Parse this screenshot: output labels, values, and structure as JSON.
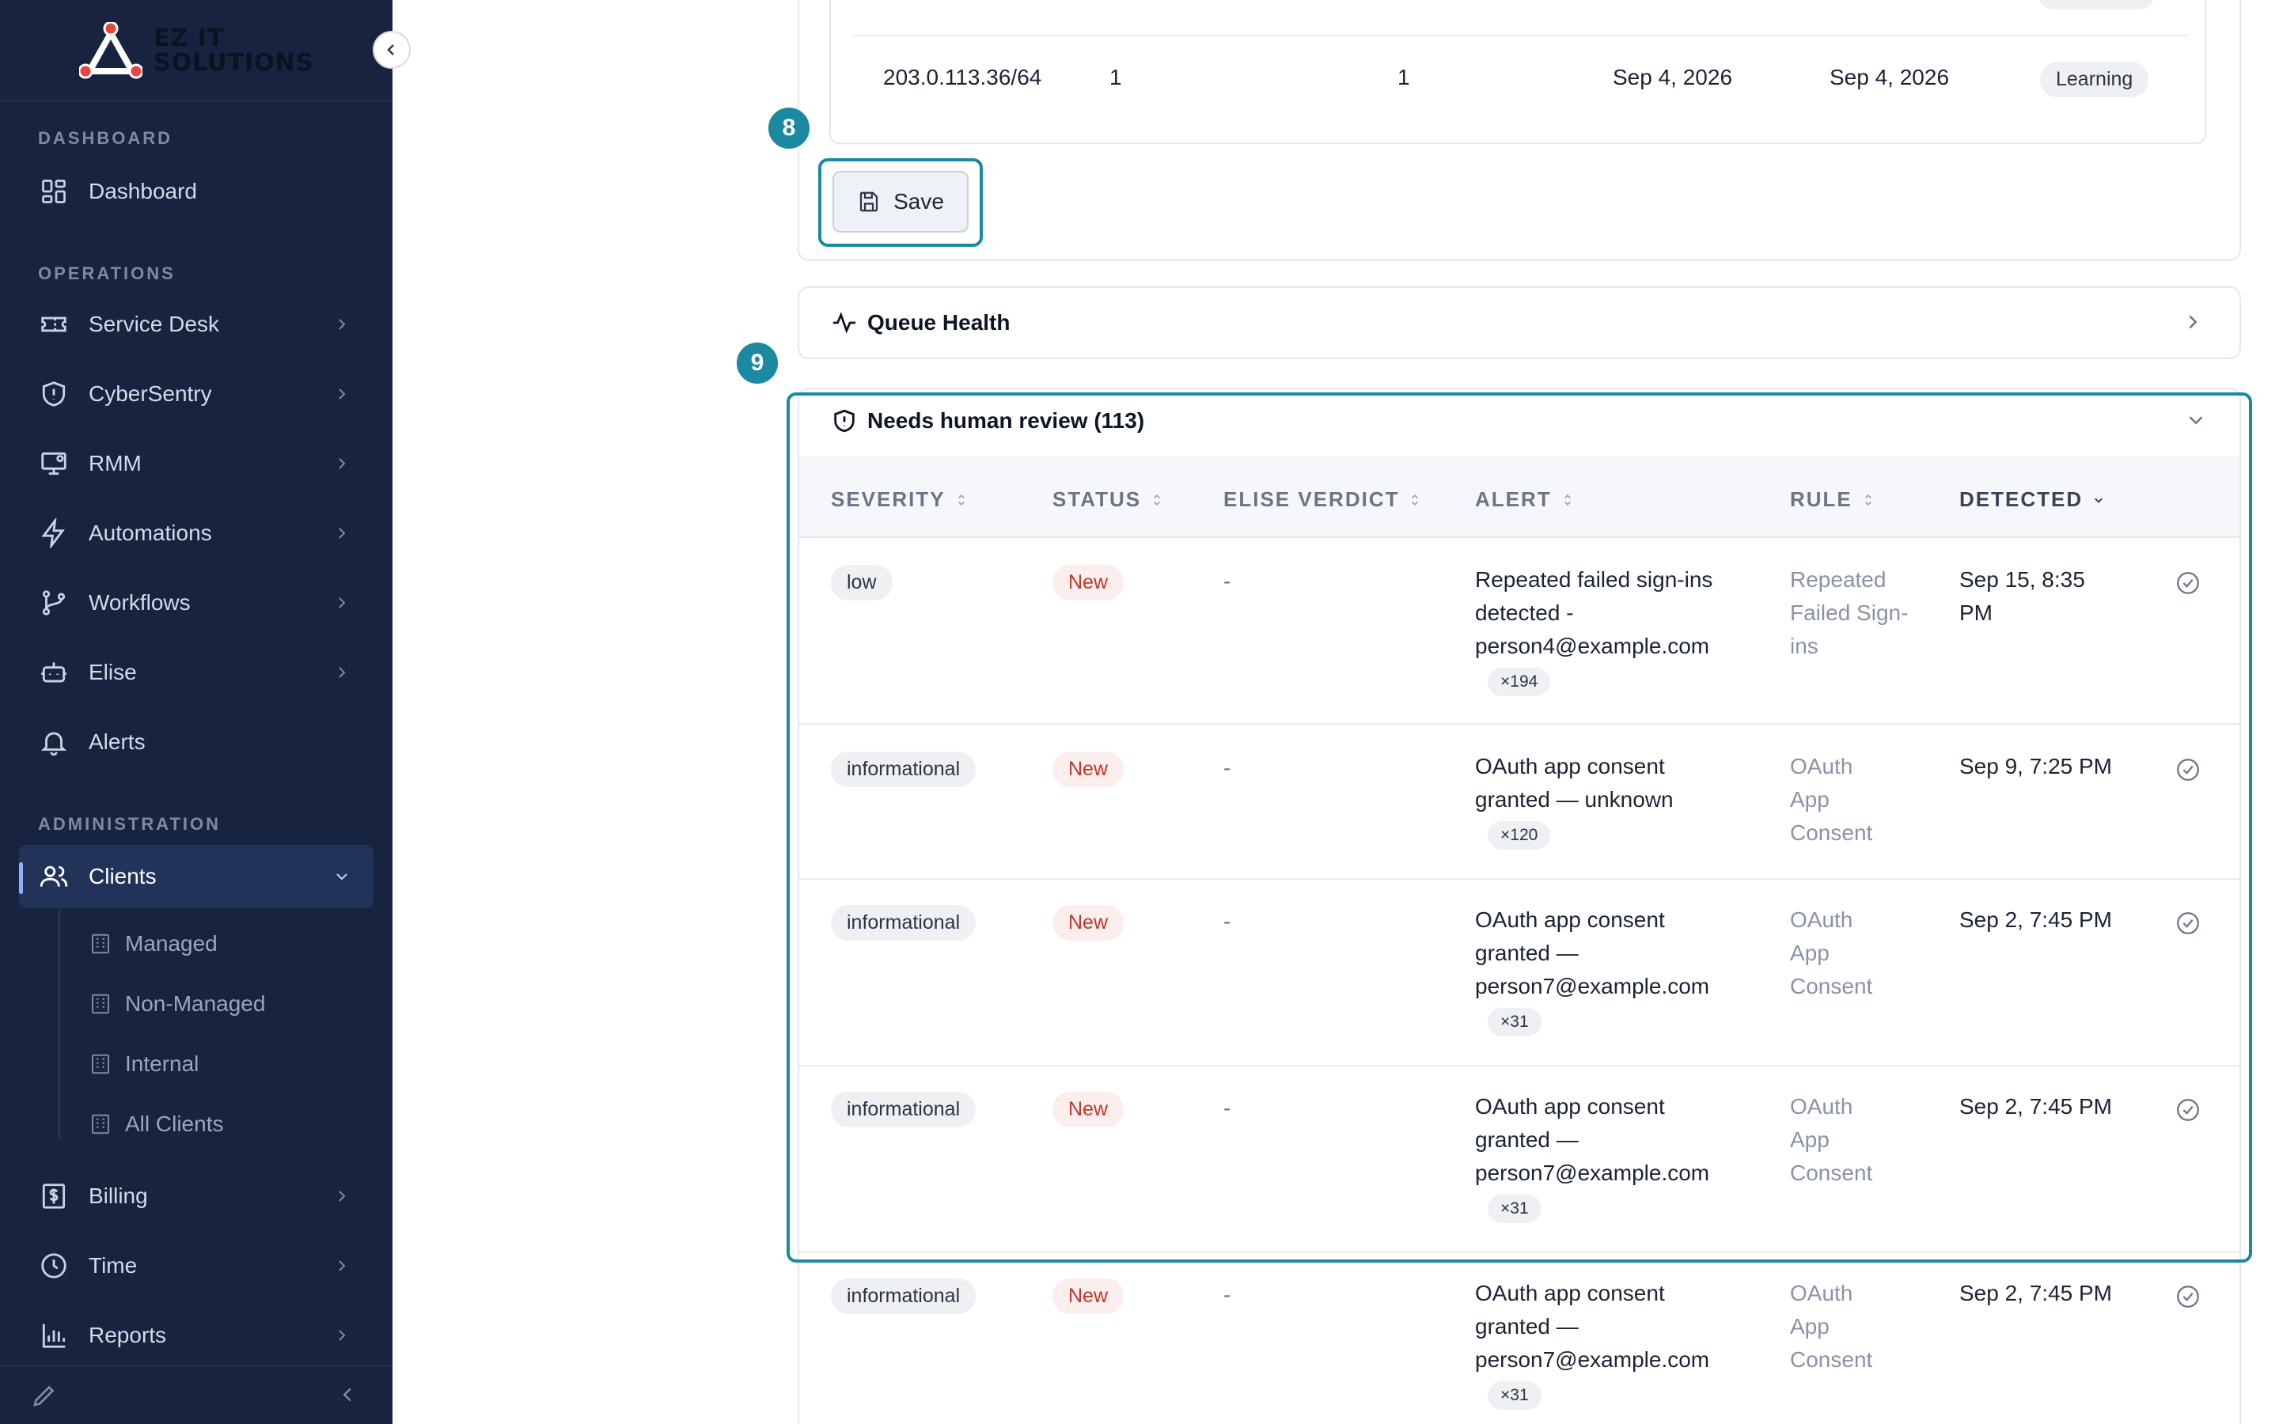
{
  "brand": {
    "name_line1": "EZ IT",
    "name_line2": "SOLUTIONS"
  },
  "sidebar": {
    "sections": [
      {
        "label": "DASHBOARD"
      },
      {
        "label": "OPERATIONS"
      },
      {
        "label": "ADMINISTRATION"
      }
    ],
    "items": [
      {
        "label": "Dashboard",
        "icon": "dashboard-icon"
      },
      {
        "label": "Service Desk",
        "icon": "ticket-icon"
      },
      {
        "label": "CyberSentry",
        "icon": "shield-icon"
      },
      {
        "label": "RMM",
        "icon": "monitor-icon"
      },
      {
        "label": "Automations",
        "icon": "lightning-icon"
      },
      {
        "label": "Workflows",
        "icon": "workflow-icon"
      },
      {
        "label": "Elise",
        "icon": "bot-icon"
      },
      {
        "label": "Alerts",
        "icon": "bell-icon"
      },
      {
        "label": "Clients",
        "icon": "users-icon"
      },
      {
        "label": "Billing",
        "icon": "billing-icon"
      },
      {
        "label": "Time",
        "icon": "clock-icon"
      },
      {
        "label": "Reports",
        "icon": "chart-icon"
      }
    ],
    "client_sub_items": [
      {
        "label": "Managed"
      },
      {
        "label": "Non-Managed"
      },
      {
        "label": "Internal"
      },
      {
        "label": "All Clients"
      }
    ]
  },
  "ip_table": {
    "row": {
      "ip": "203.0.113.36/64",
      "col2": "1",
      "col3": "1",
      "first_seen": "Sep 4, 2026",
      "last_seen": "Sep 4, 2026",
      "status": "Learning"
    }
  },
  "markers": {
    "save": "8",
    "review": "9"
  },
  "save_button": {
    "label": "Save"
  },
  "queue_health": {
    "title": "Queue Health"
  },
  "review": {
    "title": "Needs human review (113)",
    "columns": [
      "SEVERITY",
      "STATUS",
      "ELISE VERDICT",
      "ALERT",
      "RULE",
      "DETECTED"
    ],
    "rows": [
      {
        "severity": "low",
        "status": "New",
        "verdict": "-",
        "alert": "Repeated failed sign-ins detected - person4@example.com",
        "count": "×194",
        "rule": "Repeated Failed Sign-ins",
        "detected": "Sep 15, 8:35 PM"
      },
      {
        "severity": "informational",
        "status": "New",
        "verdict": "-",
        "alert": "OAuth app consent granted — unknown",
        "count": "×120",
        "rule": "OAuth App Consent",
        "detected": "Sep 9, 7:25 PM"
      },
      {
        "severity": "informational",
        "status": "New",
        "verdict": "-",
        "alert": "OAuth app consent granted — person7@example.com",
        "count": "×31",
        "rule": "OAuth App Consent",
        "detected": "Sep 2, 7:45 PM"
      },
      {
        "severity": "informational",
        "status": "New",
        "verdict": "-",
        "alert": "OAuth app consent granted — person7@example.com",
        "count": "×31",
        "rule": "OAuth App Consent",
        "detected": "Sep 2, 7:45 PM"
      },
      {
        "severity": "informational",
        "status": "New",
        "verdict": "-",
        "alert": "OAuth app consent granted — person7@example.com",
        "count": "×31",
        "rule": "OAuth App Consent",
        "detected": "Sep 2, 7:45 PM"
      }
    ]
  },
  "colors": {
    "sidebar_bg": "#17233f",
    "accent": "#1b8aa0",
    "new_status": "#c0392b"
  }
}
